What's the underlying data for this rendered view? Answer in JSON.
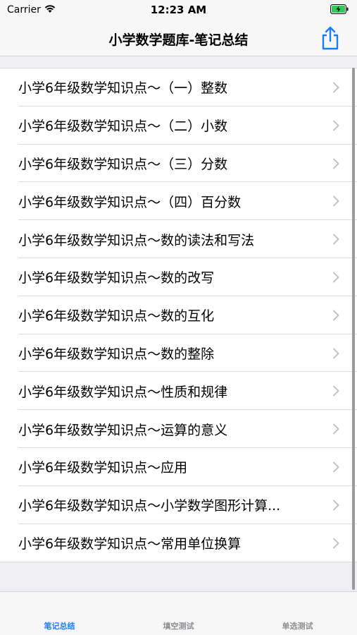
{
  "status_bar": {
    "carrier": "Carrier",
    "time": "12:23 AM",
    "icons": [
      "wifi-icon",
      "battery-charging-icon"
    ]
  },
  "nav": {
    "title": "小学数学题库-笔记总结",
    "share_icon": "share-icon"
  },
  "list": {
    "items": [
      {
        "label": "小学6年级数学知识点～（一）整数"
      },
      {
        "label": "小学6年级数学知识点～（二）小数"
      },
      {
        "label": "小学6年级数学知识点～（三）分数"
      },
      {
        "label": "小学6年级数学知识点～（四）百分数"
      },
      {
        "label": "小学6年级数学知识点～数的读法和写法"
      },
      {
        "label": "小学6年级数学知识点～数的改写"
      },
      {
        "label": "小学6年级数学知识点～数的互化"
      },
      {
        "label": "小学6年级数学知识点～数的整除"
      },
      {
        "label": "小学6年级数学知识点～性质和规律"
      },
      {
        "label": "小学6年级数学知识点～运算的意义"
      },
      {
        "label": "小学6年级数学知识点～应用"
      },
      {
        "label": "小学6年级数学知识点～小学数学图形计算..."
      },
      {
        "label": "小学6年级数学知识点～常用单位换算"
      }
    ]
  },
  "tab_bar": {
    "tabs": [
      {
        "label": "笔记总结",
        "active": true
      },
      {
        "label": "填空测试",
        "active": false
      },
      {
        "label": "单选测试",
        "active": false
      }
    ]
  },
  "colors": {
    "accent": "#1a7cf5",
    "tab_inactive": "#8e8e93",
    "background": "#efeff4"
  }
}
